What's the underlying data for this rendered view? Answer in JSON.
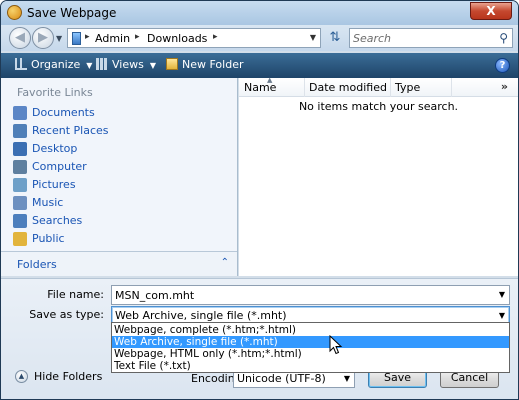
{
  "window": {
    "title": "Save Webpage",
    "close_glyph": "X"
  },
  "address": {
    "crumbs": [
      "Admin",
      "Downloads"
    ],
    "search_placeholder": "Search"
  },
  "toolbar": {
    "organize_label": "Organize",
    "views_label": "Views",
    "new_folder_label": "New Folder"
  },
  "nav_pane": {
    "heading": "Favorite Links",
    "links": [
      {
        "label": "Documents",
        "icon": "documents-icon",
        "color": "#5b86c6"
      },
      {
        "label": "Recent Places",
        "icon": "recent-places-icon",
        "color": "#4f7fb8"
      },
      {
        "label": "Desktop",
        "icon": "desktop-icon",
        "color": "#3b6fb3"
      },
      {
        "label": "Computer",
        "icon": "computer-icon",
        "color": "#5e7f9f"
      },
      {
        "label": "Pictures",
        "icon": "pictures-icon",
        "color": "#6ea0c8"
      },
      {
        "label": "Music",
        "icon": "music-icon",
        "color": "#6d90c0"
      },
      {
        "label": "Searches",
        "icon": "searches-icon",
        "color": "#4d7fbd"
      },
      {
        "label": "Public",
        "icon": "public-icon",
        "color": "#e2b43c"
      }
    ],
    "folders_label": "Folders"
  },
  "file_list": {
    "columns": [
      "Name",
      "Date modified",
      "Type"
    ],
    "empty_message": "No items match your search."
  },
  "form": {
    "file_name_label": "File name:",
    "file_name_value": "MSN_com.mht",
    "save_type_label": "Save as type:",
    "save_type_value": "Web Archive, single file (*.mht)",
    "save_type_options": [
      "Webpage, complete (*.htm;*.html)",
      "Web Archive, single file (*.mht)",
      "Webpage, HTML only (*.htm;*.html)",
      "Text File (*.txt)"
    ],
    "selected_option_index": 1,
    "hide_folders_label": "Hide Folders",
    "encoding_label": "Encoding:",
    "encoding_value": "Unicode (UTF-8)",
    "save_button": "Save",
    "cancel_button": "Cancel"
  }
}
